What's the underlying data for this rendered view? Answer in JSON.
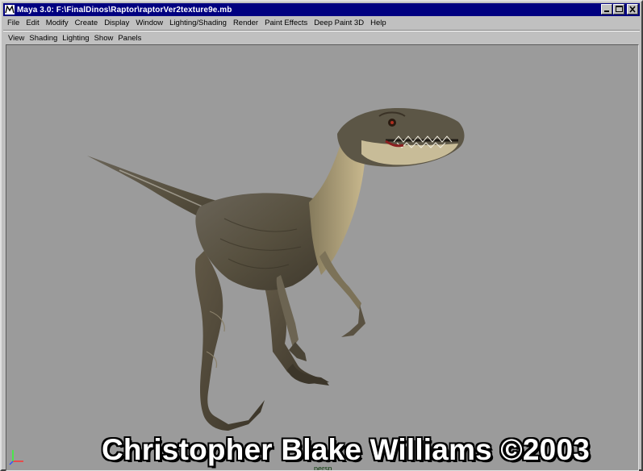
{
  "window": {
    "title": "Maya 3.0: F:\\FinalDinos\\Raptor\\raptorVer2texture9e.mb",
    "controls": [
      "minimize",
      "maximize",
      "close"
    ]
  },
  "menubar": {
    "items": [
      "File",
      "Edit",
      "Modify",
      "Create",
      "Display",
      "Window",
      "Lighting/Shading",
      "Render",
      "Paint Effects",
      "Deep Paint 3D",
      "Help"
    ]
  },
  "panel_menu": {
    "items": [
      "View",
      "Shading",
      "Lighting",
      "Show",
      "Panels"
    ]
  },
  "viewport": {
    "camera_label": "persp",
    "watermark": "Christopher Blake Williams ©2003",
    "background_color": "#9b9b9b",
    "axis_colors": {
      "x": "#ff3030",
      "y": "#30ff30",
      "z": "#3050ff"
    }
  },
  "colors": {
    "titlebar": "#000080",
    "chrome": "#c0c0c0"
  }
}
